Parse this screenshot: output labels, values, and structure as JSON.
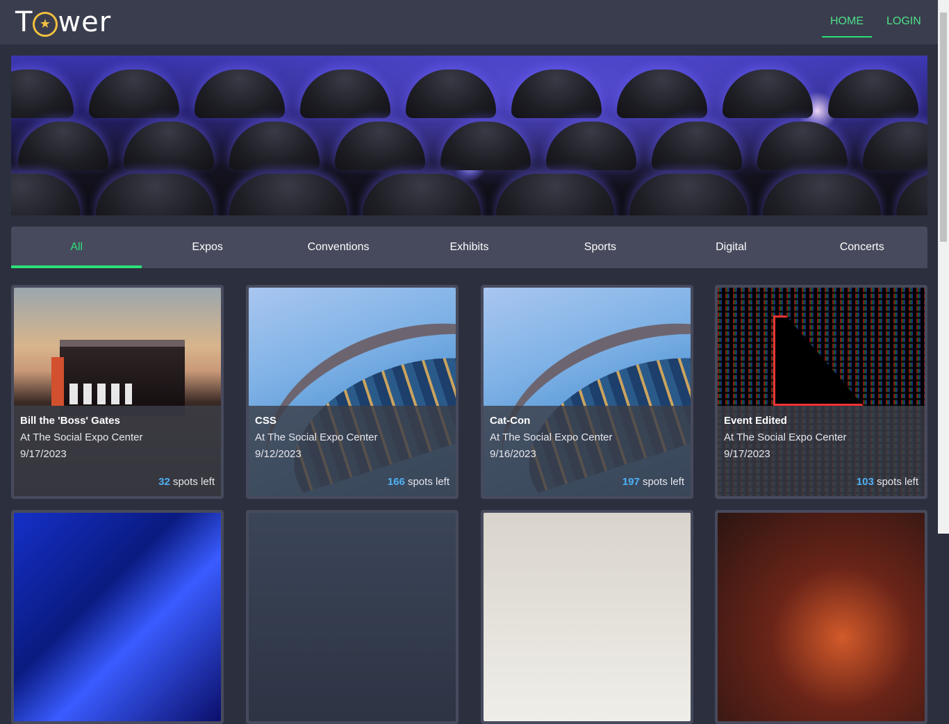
{
  "brand": {
    "name_part1": "T",
    "name_part2": "wer",
    "badge_glyph": "★"
  },
  "nav": {
    "home": "HOME",
    "login": "LOGIN"
  },
  "tabs": [
    "All",
    "Expos",
    "Conventions",
    "Exhibits",
    "Sports",
    "Digital",
    "Concerts"
  ],
  "events": [
    {
      "title": "Bill the 'Boss' Gates",
      "location": "At The Social Expo Center",
      "date": "9/17/2023",
      "spots": "32",
      "spots_label": " spots left"
    },
    {
      "title": "CSS",
      "location": "At The Social Expo Center",
      "date": "9/12/2023",
      "spots": "166",
      "spots_label": " spots left"
    },
    {
      "title": "Cat-Con",
      "location": "At The Social Expo Center",
      "date": "9/16/2023",
      "spots": "197",
      "spots_label": " spots left"
    },
    {
      "title": "Event Edited",
      "location": "At The Social Expo Center",
      "date": "9/17/2023",
      "spots": "103",
      "spots_label": " spots left"
    }
  ],
  "colors": {
    "accent": "#2de07a",
    "spots": "#4fb1f5",
    "background": "#2c2f3d",
    "nav": "#3a3d4d",
    "card": "#474a5c"
  }
}
